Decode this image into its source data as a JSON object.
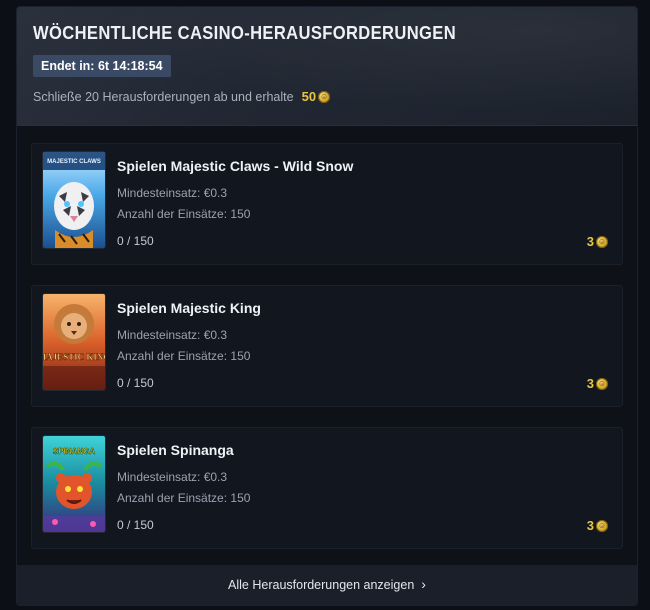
{
  "header": {
    "title": "WÖCHENTLICHE CASINO-HERAUSFORDERUNGEN",
    "timer": "Endet in: 6t 14:18:54",
    "subtitle": "Schließe 20 Herausforderungen ab und erhalte",
    "total_reward": "50"
  },
  "challenges": [
    {
      "title": "Spielen Majestic Claws - Wild Snow",
      "min_stake": "Mindesteinsatz: €0.3",
      "bet_count": "Anzahl der Einsätze: 150",
      "progress": "0 / 150",
      "reward": "3",
      "thumb_text": "MAJESTIC CLAWS",
      "thumb_icon": "tiger-icon"
    },
    {
      "title": "Spielen Majestic King",
      "min_stake": "Mindesteinsatz: €0.3",
      "bet_count": "Anzahl der Einsätze: 150",
      "progress": "0 / 150",
      "reward": "3",
      "thumb_text": "MAJESTIC KING",
      "thumb_icon": "lion-icon"
    },
    {
      "title": "Spielen Spinanga",
      "min_stake": "Mindesteinsatz: €0.3",
      "bet_count": "Anzahl der Einsätze: 150",
      "progress": "0 / 150",
      "reward": "3",
      "thumb_text": "SPINANGA",
      "thumb_icon": "jungle-cat-icon"
    }
  ],
  "footer": {
    "link": "Alle Herausforderungen anzeigen"
  },
  "colors": {
    "accent_gold": "#e9c544",
    "timer_bg": "#3a4a64",
    "panel_bg": "#0e1117"
  }
}
